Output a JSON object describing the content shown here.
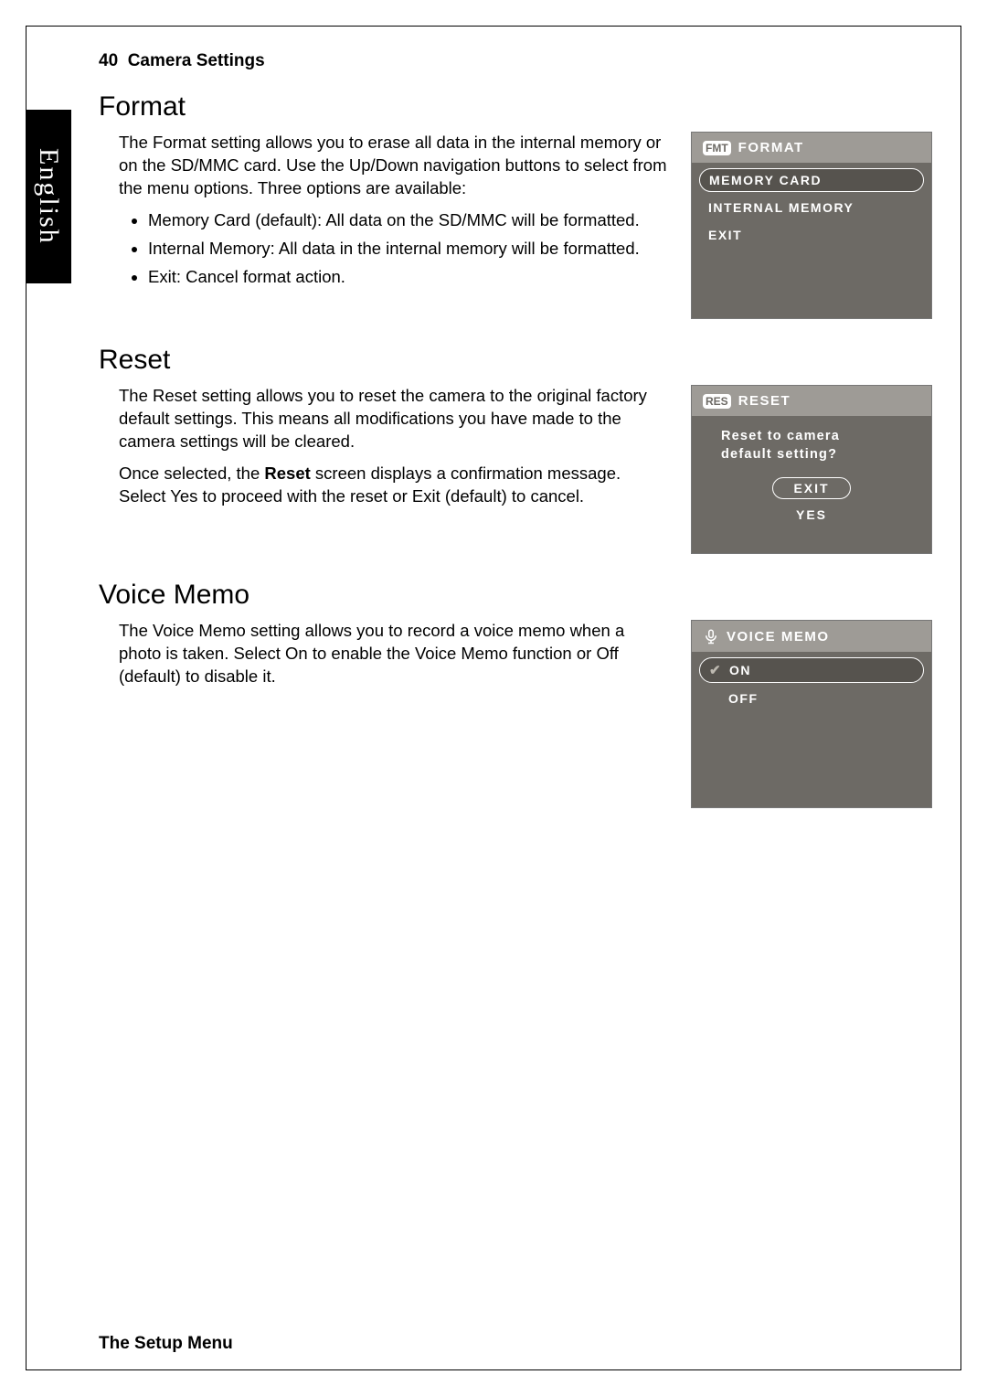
{
  "header": {
    "page_num": "40",
    "title": "Camera Settings"
  },
  "footer": {
    "title": "The Setup Menu"
  },
  "language_tab": "English",
  "sections": {
    "format": {
      "title": "Format",
      "para1_a": "The ",
      "para1_term": "Format",
      "para1_b": " setting allows you to erase all data in the internal memory or on the SD/MMC card. Use the ",
      "para1_term2": "Up/Down",
      "para1_c": " navigation buttons to select from the menu options. Three options are available:",
      "bullets": [
        "Memory Card (default): All data on the SD/MMC will be formatted.",
        "Internal Memory: All data in the internal memory will be formatted.",
        "Exit: Cancel format action."
      ],
      "screen": {
        "header_label": "FORMAT",
        "icon": "FMT",
        "items": [
          {
            "label": "MEMORY CARD",
            "selected": true
          },
          {
            "label": "INTERNAL MEMORY",
            "selected": false
          },
          {
            "label": "EXIT",
            "selected": false
          }
        ]
      }
    },
    "reset": {
      "title": "Reset",
      "para1_a": "The ",
      "para1_term": "Reset",
      "para1_b": " setting allows you to reset the camera to the original factory default settings. This means all modifications you have made to the camera settings will be cleared.",
      "para2_a": "Once selected, the ",
      "para2_bold": "Reset",
      "para2_b": " screen displays a confirmation message. Select ",
      "para2_term_yes": "Yes",
      "para2_c": " to proceed with the reset or ",
      "para2_term_exit": "Exit",
      "para2_d": " (default) to cancel.",
      "screen": {
        "header_label": "RESET",
        "icon": "RES",
        "confirm_line1": "Reset to camera",
        "confirm_line2": "default setting?",
        "options": [
          {
            "label": "EXIT",
            "selected": true
          },
          {
            "label": "YES",
            "selected": false
          }
        ]
      }
    },
    "voice": {
      "title": "Voice Memo",
      "para1_a": "The ",
      "para1_term": "Voice Memo",
      "para1_b": " setting allows you to record a voice memo when a photo is taken. Select ",
      "para1_term_on": "On",
      "para1_c": " to enable the Voice Memo function or ",
      "para1_term_off": "Off",
      "para1_d": " (default) to disable it.",
      "screen": {
        "header_label": "VOICE MEMO",
        "items": [
          {
            "label": "ON",
            "selected": true,
            "checked": true
          },
          {
            "label": "OFF",
            "selected": false,
            "checked": false
          }
        ]
      }
    }
  }
}
